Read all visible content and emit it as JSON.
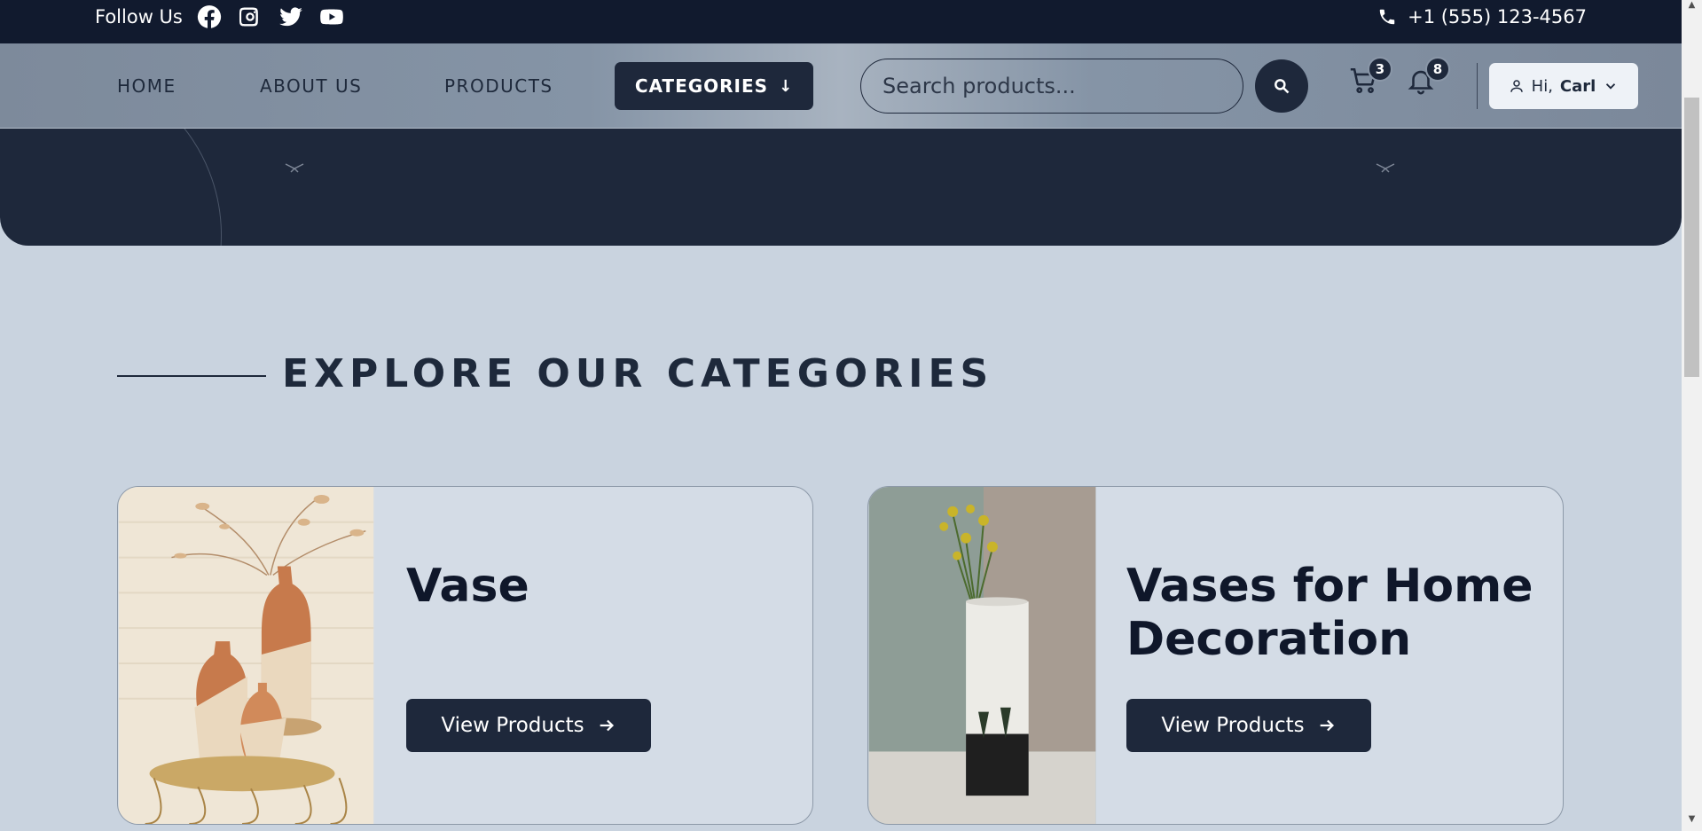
{
  "topbar": {
    "follow_label": "Follow Us",
    "social_icons": [
      "facebook-icon",
      "instagram-icon",
      "twitter-icon",
      "youtube-icon"
    ],
    "phone": "+1 (555) 123-4567"
  },
  "nav": {
    "links": [
      "HOME",
      "ABOUT US",
      "PRODUCTS"
    ],
    "categories_label": "CATEGORIES",
    "search_placeholder": "Search products...",
    "cart_count": "3",
    "notification_count": "8",
    "greeting": "Hi,",
    "user_name": "Carl"
  },
  "section": {
    "title": "EXPLORE OUR CATEGORIES"
  },
  "cards": [
    {
      "title": "Vase",
      "button_label": "View Products"
    },
    {
      "title": "Vases for Home Decoration",
      "button_label": "View Products"
    }
  ],
  "colors": {
    "primary_dark": "#1e283b",
    "topbar": "#111a2e",
    "page_background": "#c9d3df",
    "card_background": "#d4dce6"
  }
}
